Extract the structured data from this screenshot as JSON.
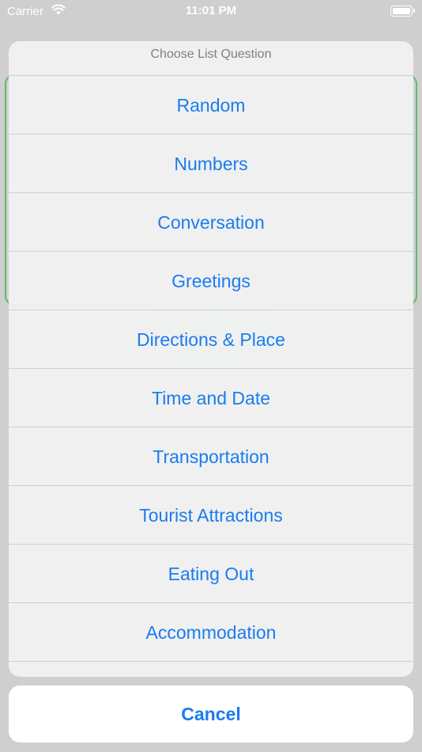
{
  "status_bar": {
    "carrier": "Carrier",
    "time": "11:01 PM",
    "wifi_icon": "wifi-icon",
    "battery_icon": "battery-icon",
    "battery_level": 1.0
  },
  "action_sheet": {
    "title": "Choose List Question",
    "options": [
      "Random",
      "Numbers",
      "Conversation",
      "Greetings",
      "Directions & Place",
      "Time and Date",
      "Transportation",
      "Tourist Attractions",
      "Eating Out",
      "Accommodation",
      ""
    ],
    "cancel_label": "Cancel"
  },
  "colors": {
    "accent": "#1a7cf0",
    "background_card_border": "#63b86a"
  }
}
